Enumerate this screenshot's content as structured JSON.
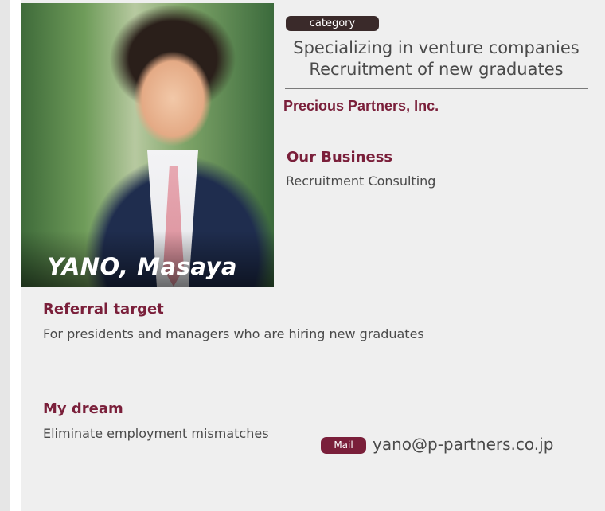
{
  "profile": {
    "name": "YANO, Masaya",
    "category_label": "category",
    "headline_line1": "Specializing in venture companies",
    "headline_line2": "Recruitment of new graduates",
    "company": "Precious Partners, Inc."
  },
  "business": {
    "heading": "Our Business",
    "text": "Recruitment Consulting"
  },
  "referral": {
    "heading": "Referral target",
    "text": "For presidents and managers who are hiring new graduates"
  },
  "dream": {
    "heading": "My dream",
    "text": "Eliminate employment mismatches"
  },
  "contact": {
    "mail_label": "Mail",
    "email": "yano@p-partners.co.jp"
  }
}
